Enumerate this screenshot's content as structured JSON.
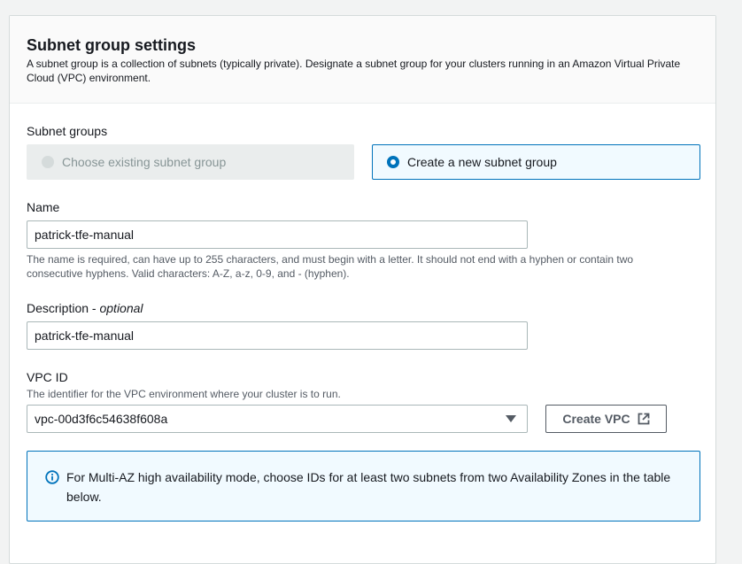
{
  "section": {
    "title": "Subnet group settings",
    "description": "A subnet group is a collection of subnets (typically private). Designate a subnet group for your clusters running in an Amazon Virtual Private Cloud (VPC) environment."
  },
  "subnet_groups": {
    "label": "Subnet groups",
    "options": [
      {
        "label": "Choose existing subnet group",
        "state": "disabled"
      },
      {
        "label": "Create a new subnet group",
        "state": "selected"
      }
    ]
  },
  "name": {
    "label": "Name",
    "value": "patrick-tfe-manual",
    "hint": "The name is required, can have up to 255 characters, and must begin with a letter. It should not end with a hyphen or contain two consecutive hyphens. Valid characters: A-Z, a-z, 0-9, and - (hyphen)."
  },
  "description": {
    "label": "Description -",
    "label_optional": "optional",
    "value": "patrick-tfe-manual"
  },
  "vpc": {
    "label": "VPC ID",
    "hint": "The identifier for the VPC environment where your cluster is to run.",
    "selected": "vpc-00d3f6c54638f608a",
    "create_button": "Create VPC",
    "create_button_icon": "external-link-icon"
  },
  "info": {
    "icon": "info-icon",
    "text": "For Multi-AZ high availability mode, choose IDs for at least two subnets from two Availability Zones in the table below."
  },
  "colors": {
    "accent": "#0073bb",
    "selected_bg": "#f1faff",
    "disabled_bg": "#eaeded",
    "page_bg": "#f2f3f3"
  }
}
